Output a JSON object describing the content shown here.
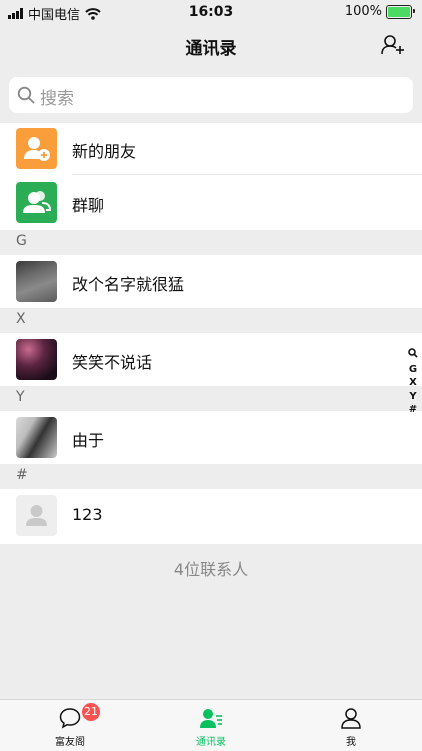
{
  "status_bar": {
    "carrier": "中国电信",
    "time": "16:03",
    "battery": "100%"
  },
  "nav": {
    "title": "通讯录"
  },
  "search": {
    "placeholder": "搜索"
  },
  "function_rows": [
    {
      "label": "新的朋友",
      "icon": "new-friend-icon",
      "color": "#fa9d3b"
    },
    {
      "label": "群聊",
      "icon": "group-chat-icon",
      "color": "#2bad55"
    }
  ],
  "sections": [
    {
      "letter": "G",
      "contacts": [
        {
          "name": "改个名字就很猛"
        }
      ]
    },
    {
      "letter": "X",
      "contacts": [
        {
          "name": "笑笑不说话"
        }
      ]
    },
    {
      "letter": "Y",
      "contacts": [
        {
          "name": "由于"
        }
      ]
    },
    {
      "letter": "#",
      "contacts": [
        {
          "name": "123"
        }
      ]
    }
  ],
  "footer": "4位联系人",
  "index_bar": [
    "G",
    "X",
    "Y",
    "#"
  ],
  "tabs": [
    {
      "label": "富友阁",
      "badge": "21",
      "icon": "chat-bubble-icon"
    },
    {
      "label": "通讯录",
      "icon": "contacts-icon",
      "active": true,
      "color": "#07c160"
    },
    {
      "label": "我",
      "icon": "person-icon"
    }
  ]
}
